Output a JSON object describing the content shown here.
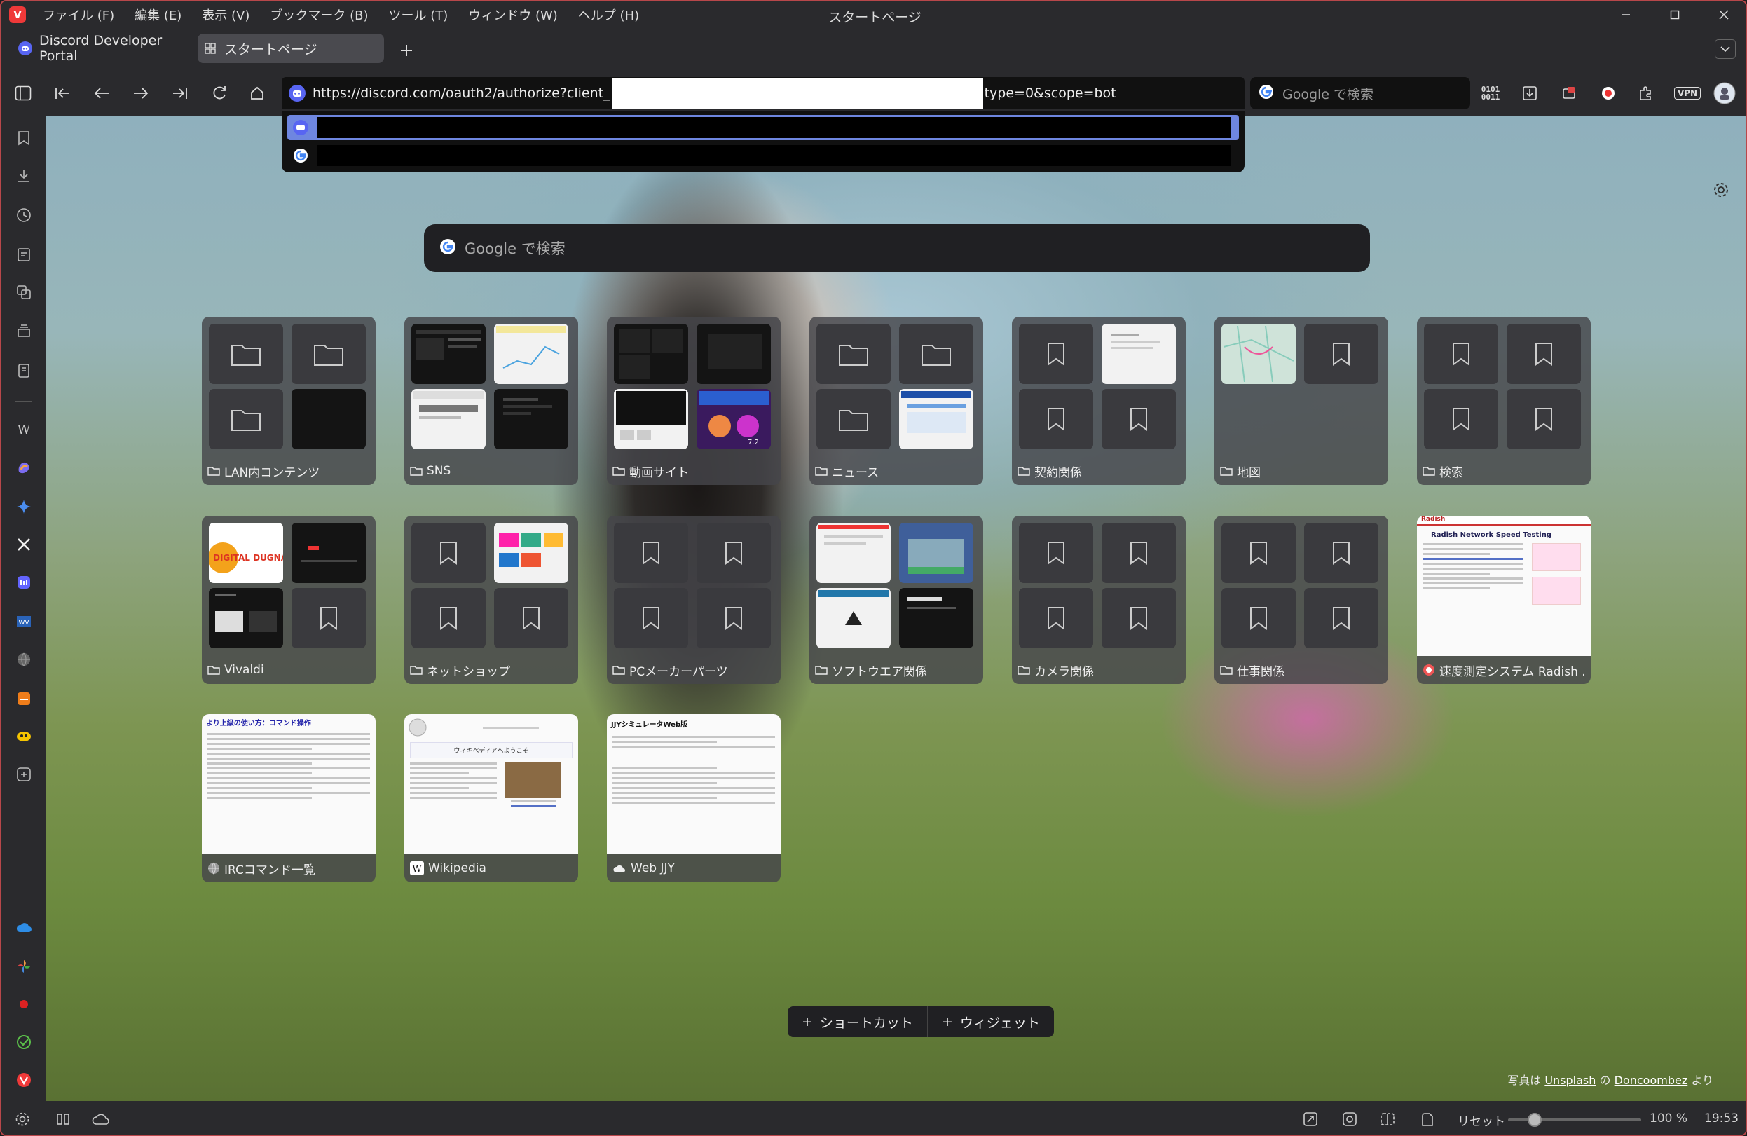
{
  "window": {
    "title": "スタートページ"
  },
  "menu": [
    "ファイル (F)",
    "編集 (E)",
    "表示 (V)",
    "ブックマーク (B)",
    "ツール (T)",
    "ウィンドウ (W)",
    "ヘルプ (H)"
  ],
  "tabs": [
    {
      "label": "Discord Developer Portal"
    },
    {
      "label": "スタートページ"
    }
  ],
  "address": {
    "url_prefix": "https://discord.com/oauth2/authorize?client_",
    "url_suffix": "type=0&scope=bot"
  },
  "search_engine_placeholder": "Google で検索",
  "page_search_placeholder": "Google で検索",
  "speed_dial": [
    {
      "label": "LAN内コンテンツ",
      "type": "folder"
    },
    {
      "label": "SNS",
      "type": "folder"
    },
    {
      "label": "動画サイト",
      "type": "folder"
    },
    {
      "label": "ニュース",
      "type": "folder"
    },
    {
      "label": "契約関係",
      "type": "folder"
    },
    {
      "label": "地図",
      "type": "folder"
    },
    {
      "label": "検索",
      "type": "folder"
    },
    {
      "label": "Vivaldi",
      "type": "folder"
    },
    {
      "label": "ネットショップ",
      "type": "folder"
    },
    {
      "label": "PCメーカーパーツ",
      "type": "folder"
    },
    {
      "label": "ソフトウエア関係",
      "type": "folder"
    },
    {
      "label": "カメラ関係",
      "type": "folder"
    },
    {
      "label": "仕事関係",
      "type": "folder"
    },
    {
      "label": "速度測定システム Radish ...",
      "type": "site"
    },
    {
      "label": "IRCコマンド一覧",
      "type": "site"
    },
    {
      "label": "Wikipedia",
      "type": "site"
    },
    {
      "label": "Web JJY",
      "type": "site"
    }
  ],
  "thumb_texts": {
    "vivaldi_logo": "DIGITAL DUGNAD",
    "radish_title": "Radish Network Speed Testing",
    "irc_title": "より上級の使い方：コマンド操作",
    "wiki_title": "ウィキペディアへようこそ",
    "jjy_title": "JJYシミュレータWeb版"
  },
  "bottom_buttons": {
    "shortcut": "ショートカット",
    "widget": "ウィジェット"
  },
  "credit": {
    "prefix": "写真は",
    "source": "Unsplash",
    "mid": "の",
    "author": "Doncoombez",
    "suffix": "より"
  },
  "status": {
    "reset": "リセット",
    "zoom": "100 %",
    "time": "19:53"
  },
  "colors": {
    "accent": "#ef3939",
    "selection": "#6e86e0",
    "discord": "#5865f2"
  }
}
